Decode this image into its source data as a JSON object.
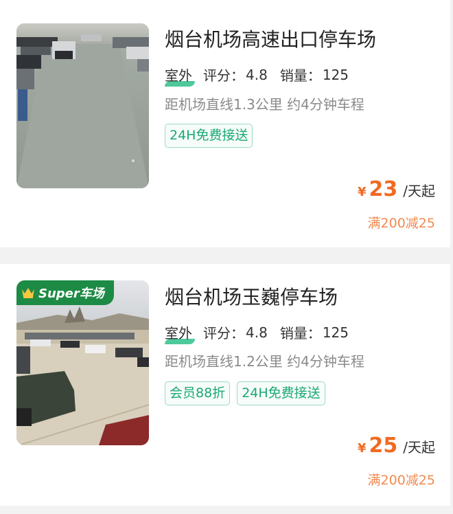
{
  "listings": [
    {
      "title": "烟台机场高速出口停车场",
      "type": "室外",
      "rating_label": "评分：",
      "rating": "4.8",
      "sales_label": "销量：",
      "sales": "125",
      "distance": "距机场直线1.3公里 约4分钟车程",
      "tags": [
        "24H免费接送"
      ],
      "currency": "¥",
      "price": "23",
      "price_unit": "/天起",
      "promo": "满200减25",
      "image": "outdoor-parking-lot-photo"
    },
    {
      "badge": "Super车场",
      "title": "烟台机场玉巍停车场",
      "type": "室外",
      "rating_label": "评分：",
      "rating": "4.8",
      "sales_label": "销量：",
      "sales": "125",
      "distance": "距机场直线1.2公里 约4分钟车程",
      "tags": [
        "会员88折",
        "24H免费接送"
      ],
      "currency": "¥",
      "price": "25",
      "price_unit": "/天起",
      "promo": "满200减25",
      "image": "outdoor-parking-lot-photo"
    }
  ],
  "colors": {
    "accent_orange": "#f06a23",
    "tag_green": "#1aa874",
    "badge_green": "#1d8b45"
  }
}
